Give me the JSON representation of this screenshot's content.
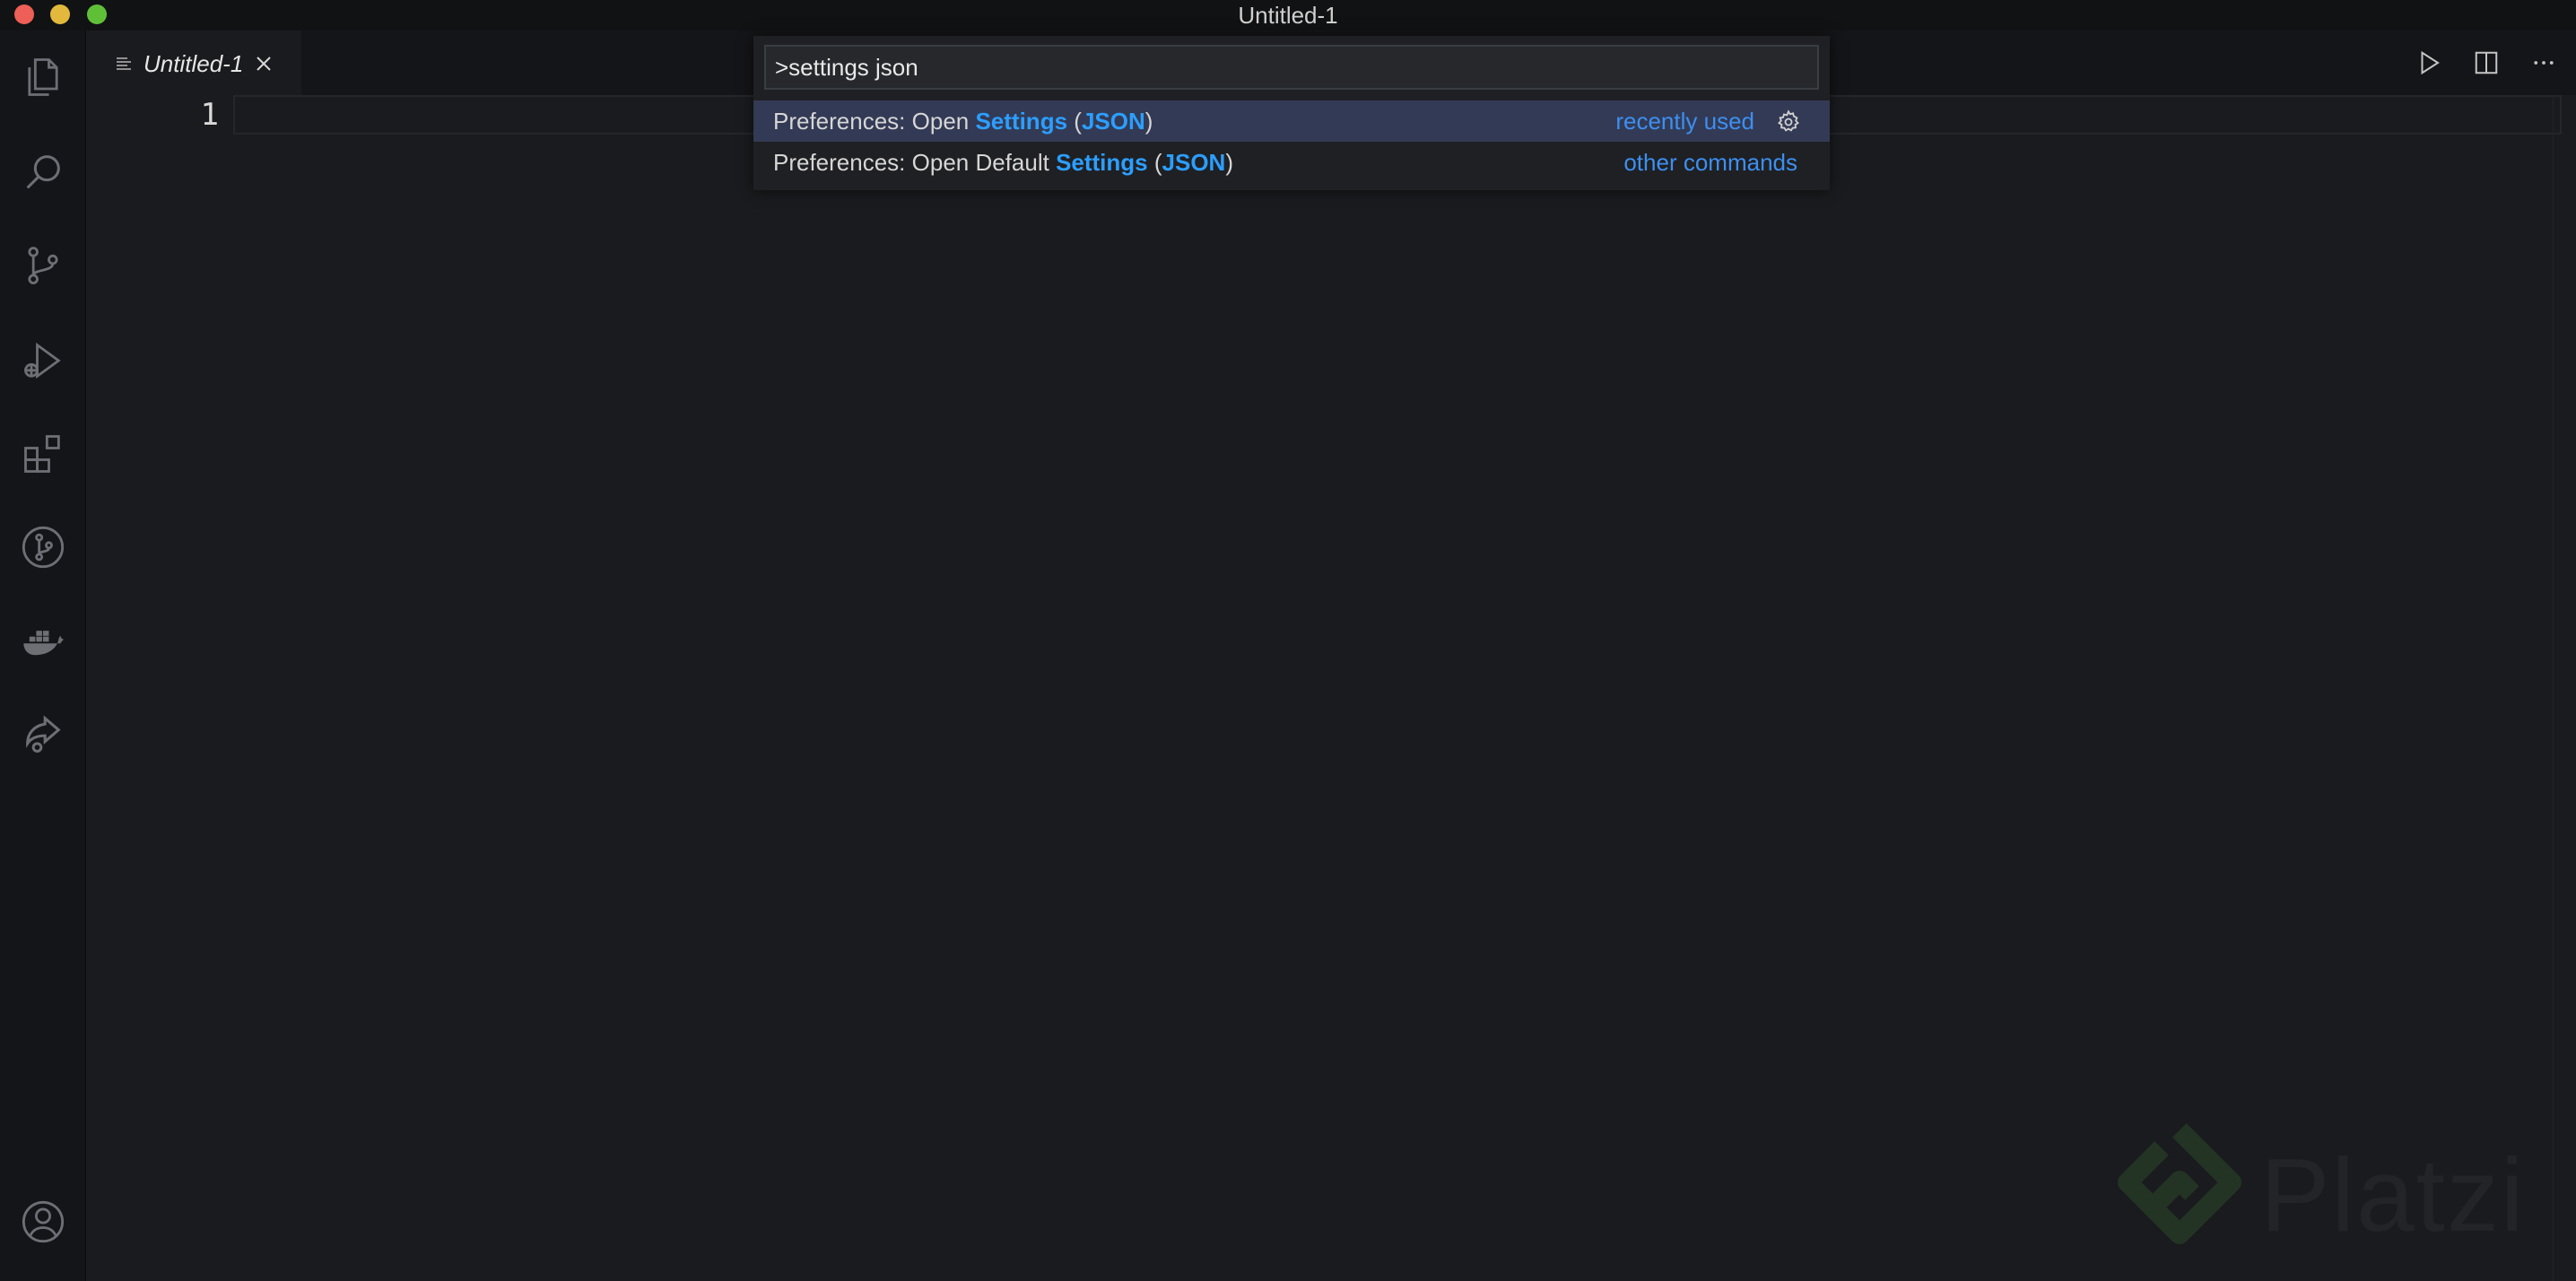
{
  "window": {
    "title": "Untitled-1"
  },
  "activity_bar": {
    "items": [
      {
        "name": "explorer-icon"
      },
      {
        "name": "search-icon"
      },
      {
        "name": "source-control-icon"
      },
      {
        "name": "run-debug-icon"
      },
      {
        "name": "extensions-icon"
      },
      {
        "name": "git-graph-icon"
      },
      {
        "name": "docker-icon"
      },
      {
        "name": "live-share-icon"
      },
      {
        "name": "accounts-icon"
      }
    ]
  },
  "tabs": [
    {
      "label": "Untitled-1",
      "active": true,
      "preview": true
    }
  ],
  "editor_actions": [
    "run-icon",
    "split-editor-icon",
    "more-actions-icon"
  ],
  "editor": {
    "line_numbers": [
      "1"
    ]
  },
  "command_palette": {
    "input_value": ">settings json",
    "items": [
      {
        "prefix": "Preferences: Open ",
        "match1": "Settings",
        "mid": " (",
        "match2": "JSON",
        "suffix": ")",
        "tag": "recently used",
        "selected": true
      },
      {
        "prefix": "Preferences: Open Default ",
        "match1": "Settings",
        "mid": " (",
        "match2": "JSON",
        "suffix": ")",
        "tag": "other commands",
        "selected": false
      }
    ]
  },
  "watermark": {
    "text": "Platzi"
  },
  "colors": {
    "accent": "#2c9eff",
    "tag": "#3d8ff0",
    "selection": "#333a55",
    "background": "#1a1b1e"
  }
}
